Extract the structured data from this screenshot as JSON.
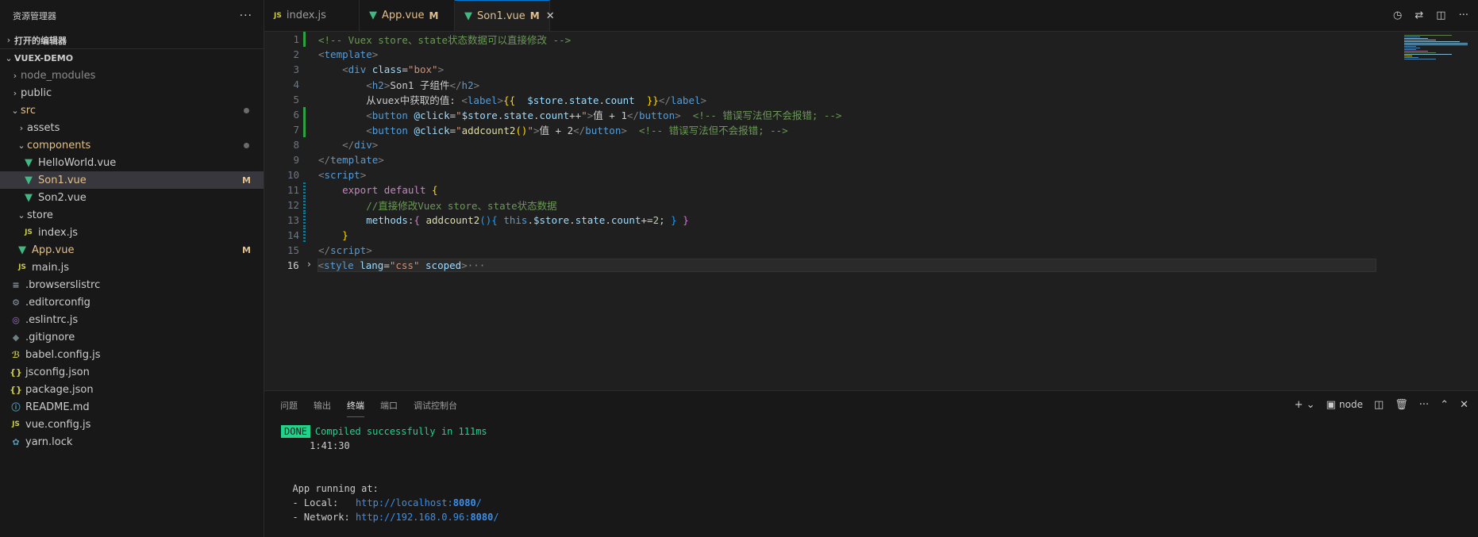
{
  "sidebar": {
    "title": "资源管理器",
    "more": "···",
    "open_editors": "打开的编辑器",
    "project": "VUEX-DEMO",
    "tree": [
      {
        "label": "node_modules",
        "depth": 1,
        "chev": "›",
        "icon": "",
        "style": "dim",
        "badge": "",
        "dot": false
      },
      {
        "label": "public",
        "depth": 1,
        "chev": "›",
        "icon": "",
        "style": "",
        "badge": "",
        "dot": false
      },
      {
        "label": "src",
        "depth": 1,
        "chev": "⌄",
        "icon": "",
        "style": "mod",
        "badge": "",
        "dot": true
      },
      {
        "label": "assets",
        "depth": 2,
        "chev": "›",
        "icon": "",
        "style": "",
        "badge": "",
        "dot": false
      },
      {
        "label": "components",
        "depth": 2,
        "chev": "⌄",
        "icon": "",
        "style": "mod",
        "badge": "",
        "dot": true
      },
      {
        "label": "HelloWorld.vue",
        "depth": 3,
        "chev": "",
        "icon": "vue",
        "style": "",
        "badge": "",
        "dot": false
      },
      {
        "label": "Son1.vue",
        "depth": 3,
        "chev": "",
        "icon": "vue",
        "style": "mod",
        "badge": "M",
        "dot": false,
        "selected": true
      },
      {
        "label": "Son2.vue",
        "depth": 3,
        "chev": "",
        "icon": "vue",
        "style": "",
        "badge": "",
        "dot": false
      },
      {
        "label": "store",
        "depth": 2,
        "chev": "⌄",
        "icon": "",
        "style": "",
        "badge": "",
        "dot": false
      },
      {
        "label": "index.js",
        "depth": 3,
        "chev": "",
        "icon": "js",
        "style": "",
        "badge": "",
        "dot": false
      },
      {
        "label": "App.vue",
        "depth": 2,
        "chev": "",
        "icon": "vue",
        "style": "mod",
        "badge": "M",
        "dot": false
      },
      {
        "label": "main.js",
        "depth": 2,
        "chev": "",
        "icon": "js",
        "style": "",
        "badge": "",
        "dot": false
      },
      {
        "label": ".browserslistrc",
        "depth": 1,
        "chev": "",
        "icon": "lines",
        "style": "",
        "badge": "",
        "dot": false
      },
      {
        "label": ".editorconfig",
        "depth": 1,
        "chev": "",
        "icon": "gear",
        "style": "",
        "badge": "",
        "dot": false
      },
      {
        "label": ".eslintrc.js",
        "depth": 1,
        "chev": "",
        "icon": "eslint",
        "style": "",
        "badge": "",
        "dot": false
      },
      {
        "label": ".gitignore",
        "depth": 1,
        "chev": "",
        "icon": "git",
        "style": "",
        "badge": "",
        "dot": false
      },
      {
        "label": "babel.config.js",
        "depth": 1,
        "chev": "",
        "icon": "babel",
        "style": "",
        "badge": "",
        "dot": false
      },
      {
        "label": "jsconfig.json",
        "depth": 1,
        "chev": "",
        "icon": "json",
        "style": "",
        "badge": "",
        "dot": false
      },
      {
        "label": "package.json",
        "depth": 1,
        "chev": "",
        "icon": "json",
        "style": "",
        "badge": "",
        "dot": false
      },
      {
        "label": "README.md",
        "depth": 1,
        "chev": "",
        "icon": "info",
        "style": "",
        "badge": "",
        "dot": false
      },
      {
        "label": "vue.config.js",
        "depth": 1,
        "chev": "",
        "icon": "js",
        "style": "",
        "badge": "",
        "dot": false
      },
      {
        "label": "yarn.lock",
        "depth": 1,
        "chev": "",
        "icon": "yarn",
        "style": "",
        "badge": "",
        "dot": false
      }
    ]
  },
  "tabs": [
    {
      "label": "index.js",
      "icon": "JS",
      "modified": "",
      "active": false
    },
    {
      "label": "App.vue",
      "icon": "vue",
      "modified": "M",
      "active": false
    },
    {
      "label": "Son1.vue",
      "icon": "vue",
      "modified": "M",
      "active": true
    }
  ],
  "code_lines": [
    {
      "n": "1",
      "html": "<span class=\"t-com\">&lt;!-- Vuex store、state状态数据可以直接修改 --&gt;</span>",
      "gutter": "add"
    },
    {
      "n": "2",
      "html": "<span class=\"t-tag\">&lt;</span><span class=\"t-tagn\">template</span><span class=\"t-tag\">&gt;</span>",
      "gutter": ""
    },
    {
      "n": "3",
      "html": "    <span class=\"t-tag\">&lt;</span><span class=\"t-tagn\">div</span> <span class=\"t-attr\">class</span>=<span class=\"t-str\">\"box\"</span><span class=\"t-tag\">&gt;</span>",
      "gutter": ""
    },
    {
      "n": "4",
      "html": "        <span class=\"t-tag\">&lt;</span><span class=\"t-tagn\">h2</span><span class=\"t-tag\">&gt;</span>Son1 子组件<span class=\"t-tag\">&lt;/</span><span class=\"t-tagn\">h2</span><span class=\"t-tag\">&gt;</span>",
      "gutter": ""
    },
    {
      "n": "5",
      "html": "        从vuex中获取的值: <span class=\"t-tag\">&lt;</span><span class=\"t-tagn\">label</span><span class=\"t-tag\">&gt;</span><span class=\"t-br\">{{</span>  <span class=\"t-prop\">$store</span>.<span class=\"t-prop\">state</span>.<span class=\"t-prop\">count</span>  <span class=\"t-br\">}}</span><span class=\"t-tag\">&lt;/</span><span class=\"t-tagn\">label</span><span class=\"t-tag\">&gt;</span>",
      "gutter": ""
    },
    {
      "n": "6",
      "html": "        <span class=\"t-tag\">&lt;</span><span class=\"t-tagn\">button</span> <span class=\"t-attr\">@click</span>=<span class=\"t-str\">\"</span><span class=\"t-prop\">$store</span>.<span class=\"t-prop\">state</span>.<span class=\"t-prop\">count</span>++<span class=\"t-str\">\"</span><span class=\"t-tag\">&gt;</span>值 + 1<span class=\"t-tag\">&lt;/</span><span class=\"t-tagn\">button</span><span class=\"t-tag\">&gt;</span>  <span class=\"t-com\">&lt;!-- 错误写法但不会报错; --&gt;</span>",
      "gutter": "add"
    },
    {
      "n": "7",
      "html": "        <span class=\"t-tag\">&lt;</span><span class=\"t-tagn\">button</span> <span class=\"t-attr\">@click</span>=<span class=\"t-str\">\"</span><span class=\"t-fn\">addcount2</span><span class=\"t-br\">()</span><span class=\"t-str\">\"</span><span class=\"t-tag\">&gt;</span>值 + 2<span class=\"t-tag\">&lt;/</span><span class=\"t-tagn\">button</span><span class=\"t-tag\">&gt;</span>  <span class=\"t-com\">&lt;!-- 错误写法但不会报错; --&gt;</span>",
      "gutter": "add"
    },
    {
      "n": "8",
      "html": "    <span class=\"t-tag\">&lt;/</span><span class=\"t-tagn\">div</span><span class=\"t-tag\">&gt;</span>",
      "gutter": ""
    },
    {
      "n": "9",
      "html": "<span class=\"t-tag\">&lt;/</span><span class=\"t-tagn\">template</span><span class=\"t-tag\">&gt;</span>",
      "gutter": ""
    },
    {
      "n": "10",
      "html": "<span class=\"t-tag\">&lt;</span><span class=\"t-tagn\">script</span><span class=\"t-tag\">&gt;</span>",
      "gutter": ""
    },
    {
      "n": "11",
      "html": "    <span class=\"t-kw\">export</span> <span class=\"t-kw\">default</span> <span class=\"t-br\">{</span>",
      "gutter": "mod"
    },
    {
      "n": "12",
      "html": "        <span class=\"t-com\">//直接修改Vuex store、state状态数据</span>",
      "gutter": "mod"
    },
    {
      "n": "13",
      "html": "        <span class=\"t-prop\">methods</span>:<span class=\"t-br2\">{</span> <span class=\"t-fn\">addcount2</span><span class=\"t-br3\">()</span><span class=\"t-br3\">{</span> <span class=\"t-kw2\">this</span>.<span class=\"t-prop\">$store</span>.<span class=\"t-prop\">state</span>.<span class=\"t-prop\">count</span>+=<span class=\"t-num\">2</span>; <span class=\"t-br3\">}</span> <span class=\"t-br2\">}</span>",
      "gutter": "mod"
    },
    {
      "n": "14",
      "html": "    <span class=\"t-br\">}</span>",
      "gutter": "mod"
    },
    {
      "n": "15",
      "html": "<span class=\"t-tag\">&lt;/</span><span class=\"t-tagn\">script</span><span class=\"t-tag\">&gt;</span>",
      "gutter": ""
    },
    {
      "n": "16",
      "html": "<span class=\"t-tag\">&lt;</span><span class=\"t-tagn\">style</span> <span class=\"t-attr\">lang</span>=<span class=\"t-str\">\"css\"</span> <span class=\"t-attr\">scoped</span><span class=\"t-tag\">&gt;</span><span class=\"t-fold\">···</span>",
      "gutter": "fold",
      "current": true
    }
  ],
  "panel": {
    "tabs": [
      "问题",
      "输出",
      "终端",
      "端口",
      "调试控制台"
    ],
    "active_tab": "终端",
    "node_label": "node",
    "term": {
      "done": "DONE",
      "compiled": "Compiled successfully in 111ms",
      "time": "1:41:30",
      "app_running": "App running at:",
      "local_label": "- Local:   ",
      "local_url": "http://localhost:",
      "local_port": "8080",
      "network_label": "- Network: ",
      "network_url": "http://192.168.0.96:",
      "network_port": "8080",
      "slash": "/"
    }
  },
  "colors": {
    "accent": "#0078d4",
    "modified": "#e2c08d",
    "vue": "#41b883",
    "done": "#23d18b"
  }
}
